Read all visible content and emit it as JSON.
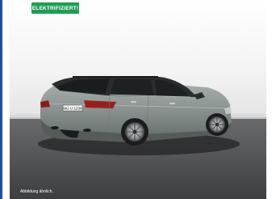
{
  "badge": {
    "label": "ELEKTRIFIZIERT!",
    "color": "#1f9d55"
  },
  "car": {
    "plate": "MÜ U 1234",
    "alt": "BMW 5 Series Touring, grey, rear three-quarter view"
  },
  "caption": {
    "text": "Abbildung ähnlich."
  },
  "colors": {
    "accent": "#1c4fa3",
    "body": "#8d9692",
    "floor": "#4a4b4d"
  }
}
